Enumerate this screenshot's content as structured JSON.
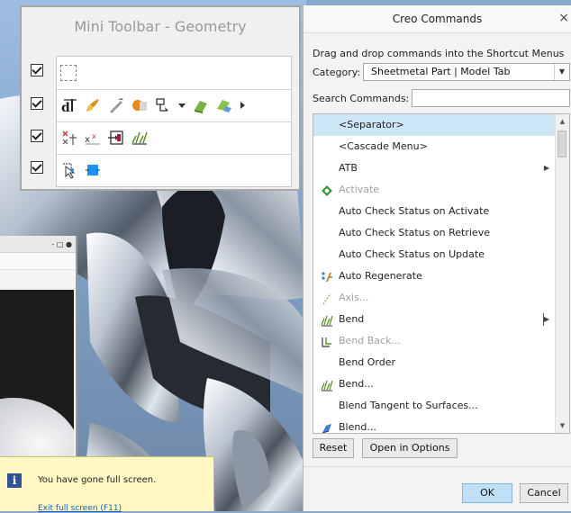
{
  "mini_toolbar": {
    "title": "Mini Toolbar - Geometry",
    "rows": [
      {
        "checked": true,
        "icons": [
          "empty-slot-icon"
        ]
      },
      {
        "checked": true,
        "icons": [
          "dimension-icon",
          "appearance-icon",
          "sketch-icon",
          "render-icon",
          "display-icon",
          "save-view-icon",
          "layer-icon",
          "more-arrow-icon"
        ]
      },
      {
        "checked": true,
        "icons": [
          "flip-icon",
          "mirror-icon",
          "insert-icon",
          "bend-icon"
        ]
      },
      {
        "checked": true,
        "icons": [
          "select-icon",
          "box-icon"
        ]
      }
    ]
  },
  "background": {
    "notification_text": "You have gone full screen.",
    "exit_link": "Exit full screen (F11)",
    "window_controls": "- □ ●"
  },
  "dialog": {
    "title": "Creo Commands",
    "close": "×",
    "instruction": "Drag and drop commands into the Shortcut Menus",
    "category_label": "Category:",
    "category_value": "Sheetmetal Part | Model Tab",
    "search_label": "Search Commands:",
    "search_value": "",
    "commands": [
      {
        "label": "<Separator>",
        "selected": true,
        "icon": ""
      },
      {
        "label": "<Cascade Menu>",
        "icon": ""
      },
      {
        "label": "ATB",
        "icon": "",
        "submenu": true
      },
      {
        "label": "Activate",
        "icon": "activate-icon",
        "disabled": true
      },
      {
        "label": "Auto Check Status on Activate",
        "icon": ""
      },
      {
        "label": "Auto Check Status on Retrieve",
        "icon": ""
      },
      {
        "label": "Auto Check Status on Update",
        "icon": ""
      },
      {
        "label": "Auto Regenerate",
        "icon": "auto-regenerate-icon"
      },
      {
        "label": "Axis...",
        "icon": "axis-icon",
        "disabled": true
      },
      {
        "label": "Bend",
        "icon": "bend-icon",
        "submenu_bar": true
      },
      {
        "label": "Bend Back...",
        "icon": "bend-back-icon",
        "disabled": true
      },
      {
        "label": "Bend Order",
        "icon": ""
      },
      {
        "label": "Bend...",
        "icon": "bend-icon"
      },
      {
        "label": "Blend Tangent to Surfaces...",
        "icon": ""
      },
      {
        "label": "Blend...",
        "icon": "blend-icon"
      }
    ],
    "reset_label": "Reset",
    "open_options_label": "Open in Options",
    "ok_label": "OK",
    "cancel_label": "Cancel"
  }
}
